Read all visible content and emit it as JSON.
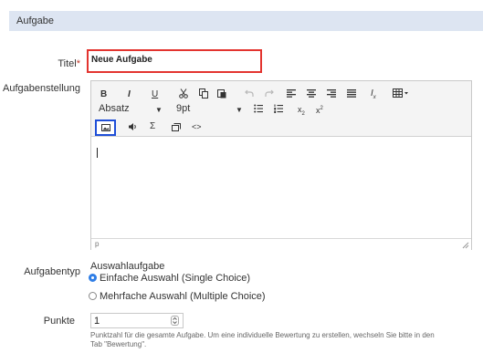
{
  "section": {
    "title": "Aufgabe"
  },
  "form": {
    "title_label": "Titel",
    "required_marker": "*",
    "title_value": "Neue Aufgabe",
    "description_label": "Aufgabenstellung",
    "type_label": "Aufgabentyp",
    "points_label": "Punkte"
  },
  "toolbar": {
    "bold": "B",
    "italic": "I",
    "underline": "U",
    "block_format": "Absatz",
    "font_size": "9pt",
    "sigma": "Σ",
    "code": "<>",
    "subscript_letter": "x",
    "subscript_mark": "2",
    "superscript_letter": "x",
    "superscript_mark": "2",
    "clear_format_letter": "I",
    "clear_format_mark": "x"
  },
  "editor": {
    "status_path": "p"
  },
  "task_type": {
    "heading": "Auswahlaufgabe",
    "options": [
      {
        "label": "Einfache Auswahl (Single Choice)",
        "selected": true
      },
      {
        "label": "Mehrfache Auswahl (Multiple Choice)",
        "selected": false
      }
    ]
  },
  "points": {
    "value": "1",
    "help_line1": "Punktzahl für die gesamte Aufgabe. Um eine individuelle Bewertung zu erstellen, wechseln Sie bitte in den",
    "help_line2": "Tab \"Bewertung\"."
  },
  "colors": {
    "header_bg": "#dde5f2",
    "highlight_red": "#e3342f",
    "highlight_blue": "#1f4fd8",
    "radio_blue": "#2f7ee6"
  }
}
